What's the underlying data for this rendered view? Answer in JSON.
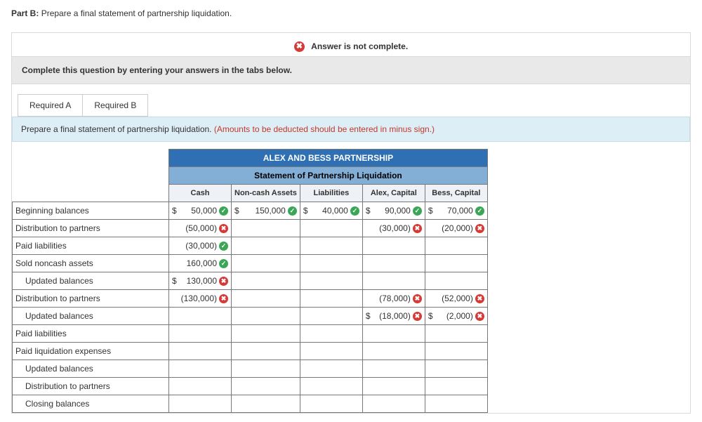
{
  "part": {
    "label": "Part B:",
    "text": "Prepare a final statement of partnership liquidation."
  },
  "alert": {
    "icon": "✖",
    "text": "Answer is not complete."
  },
  "info": "Complete this question by entering your answers in the tabs below.",
  "tabs": {
    "a": "Required A",
    "b": "Required B"
  },
  "instruction": {
    "main": "Prepare a final statement of partnership liquidation. ",
    "note": "(Amounts to be deducted should be entered in minus sign.)"
  },
  "tableTitle": "ALEX AND BESS PARTNERSHIP",
  "tableSubtitle": "Statement of Partnership Liquidation",
  "headers": {
    "cash": "Cash",
    "noncash": "Non-cash Assets",
    "liab": "Liabilities",
    "alex": "Alex, Capital",
    "bess": "Bess, Capital"
  },
  "rows": [
    {
      "label": "Beginning balances",
      "indent": false,
      "cash": {
        "ds": "$",
        "num": "50,000",
        "mark": "ok"
      },
      "noncash": {
        "ds": "$",
        "num": "150,000",
        "mark": "ok"
      },
      "liab": {
        "ds": "$",
        "num": "40,000",
        "mark": "ok"
      },
      "alex": {
        "ds": "$",
        "num": "90,000",
        "mark": "ok"
      },
      "bess": {
        "ds": "$",
        "num": "70,000",
        "mark": "ok"
      }
    },
    {
      "label": "Distribution to partners",
      "indent": false,
      "cash": {
        "num": "(50,000)",
        "mark": "bad"
      },
      "alex": {
        "num": "(30,000)",
        "mark": "bad"
      },
      "bess": {
        "num": "(20,000)",
        "mark": "bad"
      }
    },
    {
      "label": "Paid liabilities",
      "indent": false,
      "cash": {
        "num": "(30,000)",
        "mark": "ok"
      }
    },
    {
      "label": "Sold noncash assets",
      "indent": false,
      "cash": {
        "num": "160,000",
        "mark": "ok"
      }
    },
    {
      "label": "Updated balances",
      "indent": true,
      "cash": {
        "ds": "$",
        "num": "130,000",
        "mark": "bad"
      }
    },
    {
      "label": "Distribution to partners",
      "indent": false,
      "cash": {
        "num": "(130,000)",
        "mark": "bad"
      },
      "alex": {
        "num": "(78,000)",
        "mark": "bad"
      },
      "bess": {
        "num": "(52,000)",
        "mark": "bad"
      }
    },
    {
      "label": "Updated balances",
      "indent": true,
      "alex": {
        "ds": "$",
        "num": "(18,000)",
        "mark": "bad"
      },
      "bess": {
        "ds": "$",
        "num": "(2,000)",
        "mark": "bad"
      }
    },
    {
      "label": "Paid liabilities",
      "indent": false
    },
    {
      "label": "Paid liquidation expenses",
      "indent": false
    },
    {
      "label": "Updated balances",
      "indent": true
    },
    {
      "label": "Distribution to partners",
      "indent": true
    },
    {
      "label": "Closing balances",
      "indent": true
    }
  ]
}
